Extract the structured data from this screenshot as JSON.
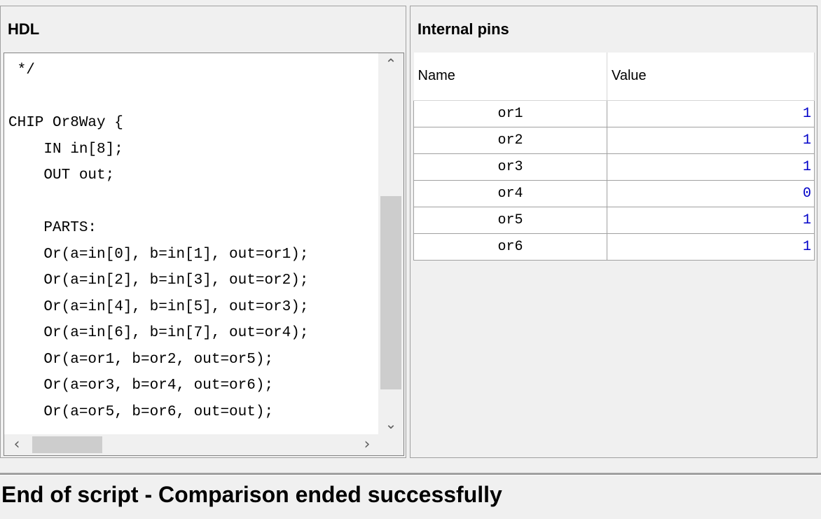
{
  "hdl": {
    "title": "HDL",
    "lines": [
      " */",
      "",
      "CHIP Or8Way {",
      "    IN in[8];",
      "    OUT out;",
      "",
      "    PARTS:",
      "    Or(a=in[0], b=in[1], out=or1);",
      "    Or(a=in[2], b=in[3], out=or2);",
      "    Or(a=in[4], b=in[5], out=or3);",
      "    Or(a=in[6], b=in[7], out=or4);",
      "    Or(a=or1, b=or2, out=or5);",
      "    Or(a=or3, b=or4, out=or6);",
      "    Or(a=or5, b=or6, out=out);"
    ],
    "scroll_icons": {
      "up": "chevron-up-icon",
      "down": "chevron-down-icon",
      "left": "chevron-left-icon",
      "right": "chevron-right-icon"
    }
  },
  "internal_pins": {
    "title": "Internal pins",
    "columns": [
      "Name",
      "Value"
    ],
    "rows": [
      {
        "name": "or1",
        "value": "1"
      },
      {
        "name": "or2",
        "value": "1"
      },
      {
        "name": "or3",
        "value": "1"
      },
      {
        "name": "or4",
        "value": "0"
      },
      {
        "name": "or5",
        "value": "1"
      },
      {
        "name": "or6",
        "value": "1"
      }
    ],
    "value_color": "#0000c8"
  },
  "status": {
    "message": "End of script - Comparison ended successfully"
  }
}
